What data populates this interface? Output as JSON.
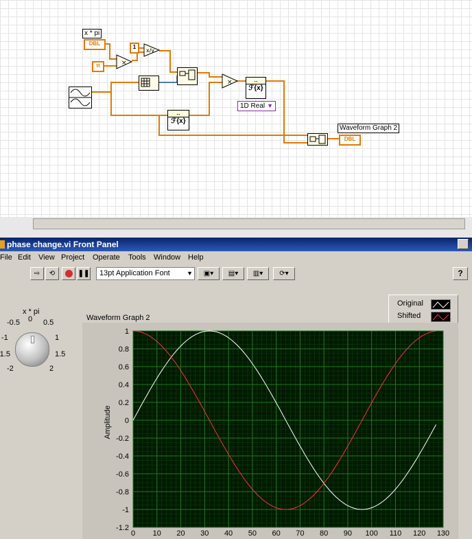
{
  "diagram": {
    "xpi_label": "x * pi",
    "dbl_terminal": "DBL",
    "pi_constant": "π",
    "one_constant": "1",
    "fft_label": "ℱ{x}",
    "mode_enum": "1D Real",
    "graph_label": "Waveform Graph 2",
    "graph_terminal": "DBL"
  },
  "window": {
    "title": "phase change.vi Front Panel"
  },
  "menu": [
    "File",
    "Edit",
    "View",
    "Project",
    "Operate",
    "Tools",
    "Window",
    "Help"
  ],
  "toolbar": {
    "font": "13pt Application Font",
    "help": "?"
  },
  "knob": {
    "label": "x * pi",
    "ticks": [
      "-0.5",
      "0",
      "0.5",
      "-1",
      "1",
      "-1.5",
      "1.5",
      "-2",
      "2"
    ],
    "value_fraction": 0.5
  },
  "legend": {
    "items": [
      {
        "name": "Original",
        "color": "#ffffff"
      },
      {
        "name": "Shifted",
        "color": "#ff3030"
      }
    ]
  },
  "chart_data": {
    "type": "line",
    "title": "Waveform Graph 2",
    "ylabel": "Amplitude",
    "xlabel": "",
    "xlim": [
      0,
      130
    ],
    "ylim": [
      -1.2,
      1
    ],
    "xticks": [
      0,
      10,
      20,
      30,
      40,
      50,
      60,
      70,
      80,
      90,
      100,
      110,
      120,
      130
    ],
    "yticks": [
      1,
      0.8,
      0.6,
      0.4,
      0.2,
      0,
      -0.2,
      -0.4,
      -0.6,
      -0.8,
      -1,
      -1.2
    ],
    "grid": true,
    "plot_bg": "#001a00",
    "grid_color": "#1f7a1f",
    "series": [
      {
        "name": "Original",
        "color": "#ffffff",
        "x_start": 0,
        "x_step": 1,
        "count": 128,
        "values_desc": "sine",
        "amplitude": 1,
        "period": 128,
        "phase": 0
      },
      {
        "name": "Shifted",
        "color": "#ff3030",
        "x_start": 0,
        "x_step": 1,
        "count": 128,
        "values_desc": "cosine",
        "amplitude": 1,
        "period": 128,
        "phase": 1.5708
      }
    ]
  }
}
